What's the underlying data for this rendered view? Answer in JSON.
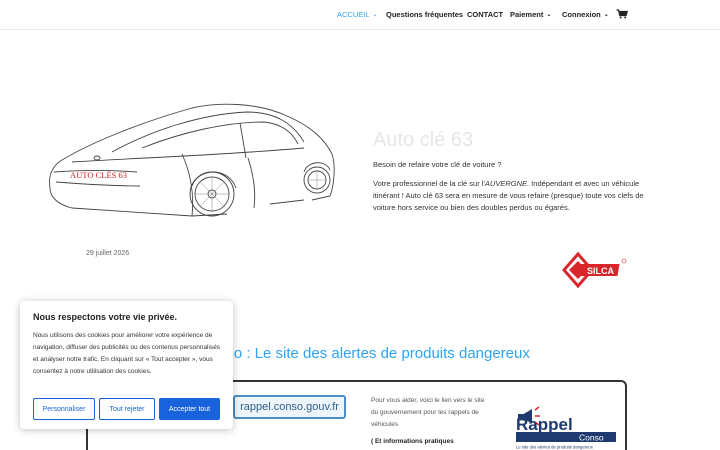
{
  "nav": {
    "items": [
      {
        "label": "ACCUEIL",
        "active": true,
        "has_dropdown": true
      },
      {
        "label": "Questions fréquentes",
        "active": false,
        "has_dropdown": false
      },
      {
        "label": "CONTACT",
        "active": false,
        "has_dropdown": false
      },
      {
        "label": "Paiement",
        "active": false,
        "has_dropdown": true
      },
      {
        "label": "Connexion",
        "active": false,
        "has_dropdown": true
      }
    ],
    "cart_icon": "shopping-cart-icon",
    "accent_color": "#2ea3f2"
  },
  "hero": {
    "car_plate_text": "AUTO CLÉS 63",
    "title": "Auto clé 63",
    "subtitle": "Besoin de refaire votre clé de voiture ?",
    "body_before": "Votre professionnel de la clé sur l'",
    "body_region": "AUVERGNE",
    "body_after": ". Indépendant et avec un véhicule itinérant ! Auto clé 63 sera en mesure de vous refaire (presque) toute vos clefs de voiture hors service ou bien des doubles perdus ou égarés.",
    "date": "29 juillet 2026"
  },
  "silca": {
    "text": "SILCA",
    "color": "#d9262b"
  },
  "rappel": {
    "section_title": "nso : Le site des alertes de produits dangereux",
    "url_label": "rappel.conso.gouv.fr",
    "help_text": "Pour vous aider, voici le lien vers le site du gouvernement pour les rappels de véhicules",
    "more_info": "( Et informations pratiques",
    "logo_main": "Rappel",
    "logo_sub": "Conso",
    "logo_tagline": "Le site des alertes de produits dangereux"
  },
  "cookie": {
    "title": "Nous respectons votre vie privée.",
    "text": "Nous utilisons des cookies pour améliorer votre expérience de navigation, diffuser des publicités ou des contenus personnalisés et analyser notre trafic. En cliquant sur « Tout accepter », vous consentez à notre utilisation des cookies.",
    "btn_customize": "Personnaliser",
    "btn_reject": "Tout rejeter",
    "btn_accept": "Accepter tout",
    "button_color": "#1863dc"
  }
}
